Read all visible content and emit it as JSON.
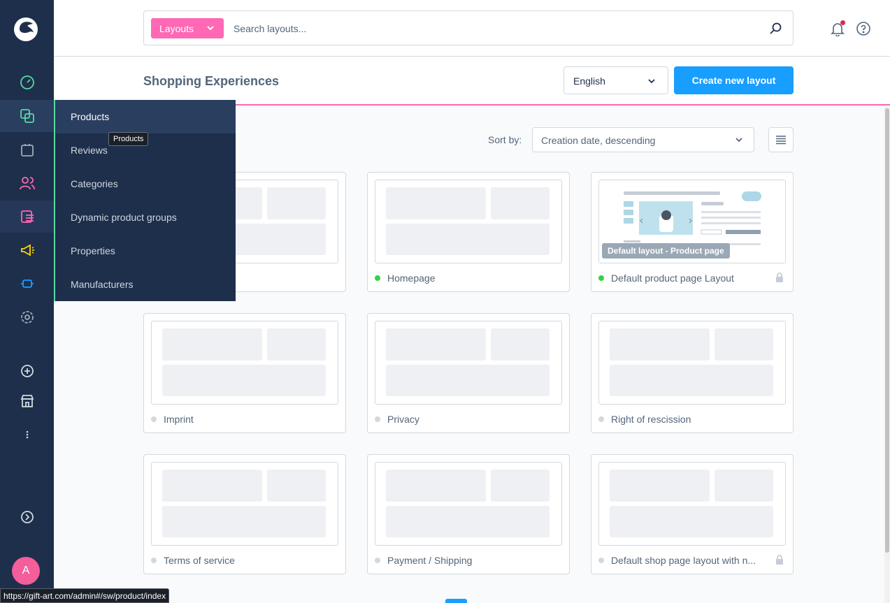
{
  "search": {
    "type_label": "Layouts",
    "placeholder": "Search layouts..."
  },
  "header": {
    "title": "Shopping Experiences",
    "language": "English",
    "create_label": "Create new layout"
  },
  "sort": {
    "label": "Sort by:",
    "value": "Creation date, descending"
  },
  "flyout": {
    "items": [
      {
        "label": "Products",
        "active": true
      },
      {
        "label": "Reviews"
      },
      {
        "label": "Categories"
      },
      {
        "label": "Dynamic product groups"
      },
      {
        "label": "Properties"
      },
      {
        "label": "Manufacturers"
      }
    ],
    "tooltip": "Products"
  },
  "sidebar": {
    "icons": [
      "dashboard-icon",
      "catalogue-icon",
      "orders-icon",
      "customers-icon",
      "content-icon",
      "marketing-icon",
      "extensions-icon",
      "settings-icon",
      "add-sales-channel-icon",
      "storefront-icon",
      "more-icon",
      "expand-icon"
    ],
    "avatar_initial": "A"
  },
  "layouts": [
    {
      "name": "",
      "active": false
    },
    {
      "name": "Homepage",
      "active": true
    },
    {
      "name": "Default product page Layout",
      "active": true,
      "locked": true,
      "badge": "Default layout - Product page"
    },
    {
      "name": "Imprint",
      "active": false
    },
    {
      "name": "Privacy",
      "active": false
    },
    {
      "name": "Right of rescission",
      "active": false
    },
    {
      "name": "Terms of service",
      "active": false
    },
    {
      "name": "Payment / Shipping",
      "active": false
    },
    {
      "name": "Default shop page layout with n...",
      "active": false,
      "locked": true
    }
  ],
  "status_url": "https://gift-art.com/admin#/sw/product/index",
  "colors": {
    "sidebar": "#1e2f4b",
    "accent_pink": "#ff68b4",
    "primary_blue": "#189eff",
    "active_green": "#37d046"
  }
}
